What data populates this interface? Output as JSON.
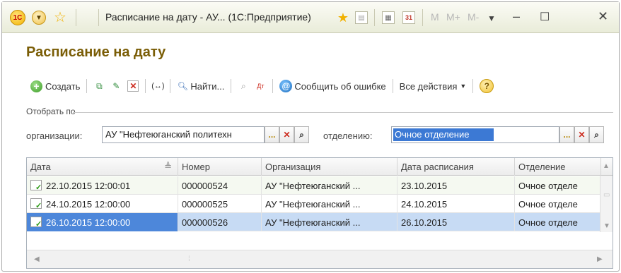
{
  "titlebar": {
    "logo": "1С",
    "title": "Расписание на дату - АУ... (1С:Предприятие)",
    "m_buttons": [
      "M",
      "M+",
      "M-"
    ],
    "icons": [
      "1c-logo-icon",
      "menu-dropdown-icon",
      "favorite-star-icon",
      "favorite-add-icon",
      "history-icon",
      "calculator-icon",
      "calendar-icon"
    ]
  },
  "page": {
    "heading": "Расписание на дату"
  },
  "toolbar": {
    "create_label": "Создать",
    "find_label": "Найти...",
    "report_error_label": "Сообщить об ошибке",
    "all_actions_label": "Все действия"
  },
  "filter": {
    "group_label": "Отобрать по",
    "org_label": "организации:",
    "org_value": "АУ \"Нефтеюганский политехн",
    "dept_label": "отделению:",
    "dept_value": "Очное отделение"
  },
  "table": {
    "columns": [
      "Дата",
      "Номер",
      "Организация",
      "Дата расписания",
      "Отделение"
    ],
    "rows": [
      {
        "date": "22.10.2015 12:00:01",
        "number": "000000524",
        "org": "АУ \"Нефтеюганский ...",
        "schedule_date": "23.10.2015",
        "dept": "Очное отделе"
      },
      {
        "date": "24.10.2015 12:00:00",
        "number": "000000525",
        "org": "АУ \"Нефтеюганский ...",
        "schedule_date": "24.10.2015",
        "dept": "Очное отделе"
      },
      {
        "date": "26.10.2015 12:00:00",
        "number": "000000526",
        "org": "АУ \"Нефтеюганский ...",
        "schedule_date": "26.10.2015",
        "dept": "Очное отделе"
      }
    ],
    "selected_row": 2
  },
  "colors": {
    "heading": "#7a5d06",
    "selection": "#3c79d4",
    "selected_row_bg": "#c7dbf4"
  }
}
